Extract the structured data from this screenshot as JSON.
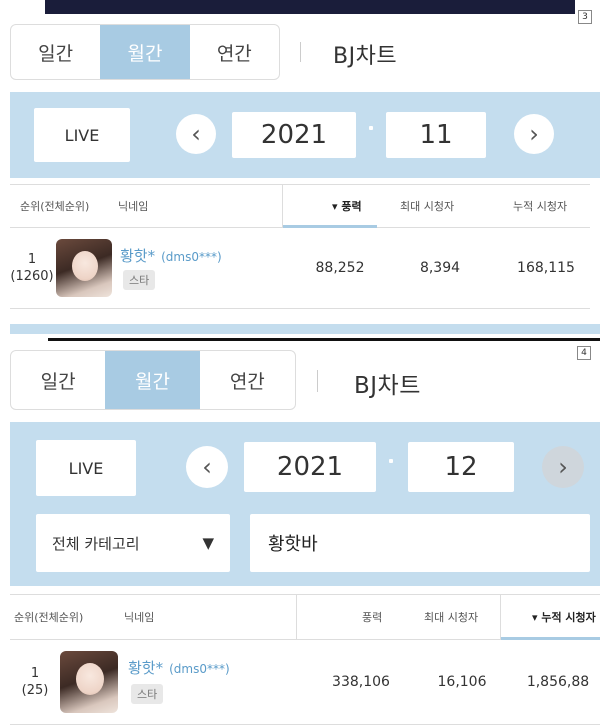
{
  "panels": [
    {
      "badge": "3",
      "tabs": [
        "일간",
        "월간",
        "연간"
      ],
      "active_tab": "월간",
      "chart_title": "BJ차트",
      "live_label": "LIVE",
      "year": "2021",
      "month": "11",
      "prev_arrow": "‹",
      "next_arrow": "›",
      "columns": [
        "순위(전체순위)",
        "닉네임",
        "▾ 풍력",
        "최대 시청자",
        "누적 시청자"
      ],
      "row": {
        "rank": "1",
        "overall_rank": "(1260)",
        "nickname": "황핫*",
        "user_id": "(dms0***)",
        "badge": "스타",
        "poongryeok": "88,252",
        "max_viewers": "8,394",
        "cumulative_viewers": "168,115"
      }
    },
    {
      "badge": "4",
      "tabs": [
        "일간",
        "월간",
        "연간"
      ],
      "active_tab": "월간",
      "chart_title": "BJ차트",
      "live_label": "LIVE",
      "year": "2021",
      "month": "12",
      "prev_arrow": "‹",
      "next_arrow": "›",
      "category": "전체 카테고리",
      "dropdown_arrow": "▼",
      "search_value": "황핫바",
      "columns": [
        "순위(전체순위)",
        "닉네임",
        "풍력",
        "최대 시청자",
        "▾ 누적 시청자"
      ],
      "row": {
        "rank": "1",
        "overall_rank": "(25)",
        "nickname": "황핫*",
        "user_id": "(dms0***)",
        "badge": "스타",
        "poongryeok": "338,106",
        "max_viewers": "16,106",
        "cumulative_viewers": "1,856,88"
      }
    }
  ],
  "colors": {
    "accent": "#a8cbe3",
    "band": "#c4ddee",
    "nickname": "#5a9bc9"
  }
}
